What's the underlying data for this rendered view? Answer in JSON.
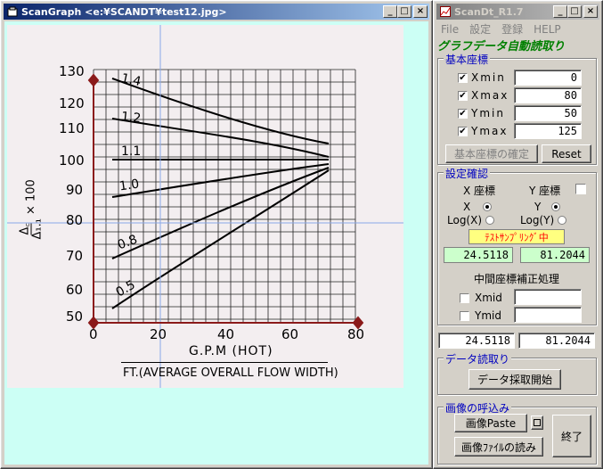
{
  "left_window": {
    "title": "ScanGraph <e:¥SCANDT¥test12.jpg>",
    "buttons": [
      "_",
      "□",
      "×"
    ]
  },
  "scan_image": {
    "y_label_numerator": "Δ꜀",
    "y_label_denominator": "Δ₁.₁",
    "y_label_suffix": "× 100",
    "x_label": "G.P.M (HOT)",
    "footnote": "FT.(AVERAGE OVERALL FLOW WIDTH)",
    "curve_labels": [
      "1.4",
      "1.2",
      "1.1",
      "1.0",
      "0.8",
      "0.5"
    ],
    "x_ticks": [
      "0",
      "20",
      "40",
      "60",
      "80"
    ],
    "y_ticks": [
      "130",
      "120",
      "110",
      "100",
      "90",
      "80",
      "70",
      "60",
      "50"
    ]
  },
  "right_window": {
    "title": "ScanDt_R1.7",
    "buttons": [
      "_",
      "□",
      "×"
    ],
    "menu": [
      "File",
      "設定",
      "登録",
      "HELP"
    ],
    "heading": "グラフデータ自動読取り",
    "base_coords": {
      "label": "基本座標",
      "rows": [
        {
          "name": "Xmin",
          "value": "0",
          "checked": "✔"
        },
        {
          "name": "Xmax",
          "value": "80",
          "checked": "✔"
        },
        {
          "name": "Ymin",
          "value": "50",
          "checked": "✔"
        },
        {
          "name": "Ymax",
          "value": "125",
          "checked": "✔"
        }
      ],
      "confirm_button": "基本座標の確定",
      "reset_button": "Reset"
    },
    "settings": {
      "label": "設定確認",
      "x_coord": "X 座標",
      "y_coord": "Y 座標",
      "x": "X",
      "y": "Y",
      "logx": "Log(X)",
      "logy": "Log(Y)",
      "sampling": "ﾃｽﾄｻﾝﾌﾟﾘﾝｸﾞ中",
      "val_x": "24.5118",
      "val_y": "81.2044",
      "mid_label": "中間座標補正処理",
      "xmid": "Xmid",
      "ymid": "Ymid"
    },
    "readout": {
      "x": "24.5118",
      "y": "81.2044"
    },
    "data_read": {
      "label": "データ読取り",
      "button": "データ採取開始"
    },
    "image_load": {
      "label": "画像の呼込み",
      "paste_button": "画像Paste",
      "file_button": "画像ﾌｧｲﾙの読み",
      "end_button": "終了"
    }
  }
}
